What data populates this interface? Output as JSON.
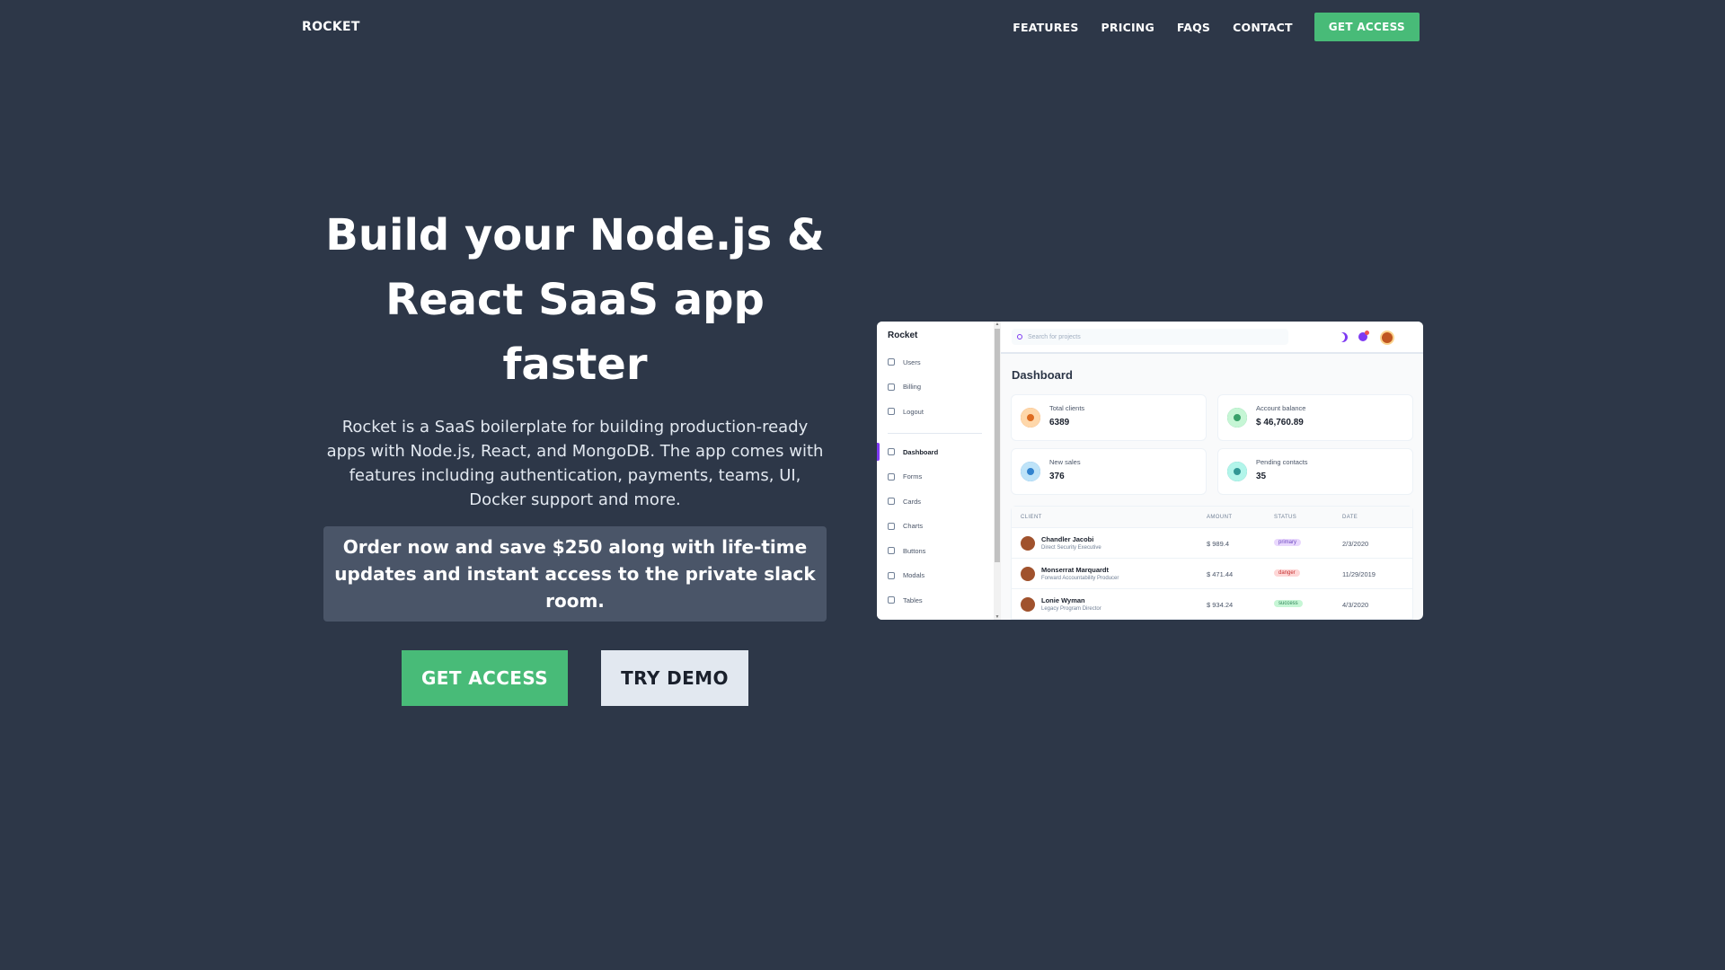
{
  "nav": {
    "logo": "ROCKET",
    "links": [
      "FEATURES",
      "PRICING",
      "FAQS",
      "CONTACT"
    ],
    "cta": "GET ACCESS"
  },
  "hero": {
    "title_lines": [
      "Build your Node.js &",
      "React SaaS app",
      "faster"
    ],
    "description": "Rocket is a SaaS boilerplate for building production-ready apps with Node.js, React, and MongoDB. The app comes with features including authentication, payments, teams, UI, Docker support and more.",
    "promo": "Order now and save $250 along with life-time updates and instant access to the private slack room.",
    "primary_button": "GET ACCESS",
    "secondary_button": "TRY DEMO"
  },
  "preview": {
    "brand": "Rocket",
    "sidebar_top": [
      "Users",
      "Billing",
      "Logout"
    ],
    "sidebar_main": [
      "Dashboard",
      "Forms",
      "Cards",
      "Charts",
      "Buttons",
      "Modals",
      "Tables"
    ],
    "active_item": "Dashboard",
    "search_placeholder": "Search for projects",
    "page_title": "Dashboard",
    "cards": [
      {
        "label": "Total clients",
        "value": "6389",
        "icon": "users-icon",
        "color": "#fed7aa",
        "fg": "#dd6b20"
      },
      {
        "label": "Account balance",
        "value": "$ 46,760.89",
        "icon": "cash-icon",
        "color": "#c6f6d5",
        "fg": "#38a169"
      },
      {
        "label": "New sales",
        "value": "376",
        "icon": "cart-icon",
        "color": "#bee3f8",
        "fg": "#3182ce"
      },
      {
        "label": "Pending contacts",
        "value": "35",
        "icon": "chat-icon",
        "color": "#b2f5ea",
        "fg": "#319795"
      }
    ],
    "table_headers": [
      "CLIENT",
      "AMOUNT",
      "STATUS",
      "DATE"
    ],
    "rows": [
      {
        "name": "Chandler Jacobi",
        "job": "Direct Security Executive",
        "amount": "$ 989.4",
        "status": "primary",
        "date": "2/3/2020"
      },
      {
        "name": "Monserrat Marquardt",
        "job": "Forward Accountability Producer",
        "amount": "$ 471.44",
        "status": "danger",
        "date": "11/29/2019"
      },
      {
        "name": "Lonie Wyman",
        "job": "Legacy Program Director",
        "amount": "$ 934.24",
        "status": "success",
        "date": "4/3/2020"
      }
    ],
    "status_colors": {
      "primary": {
        "bg": "#e9d8fd",
        "fg": "#6b46c1"
      },
      "danger": {
        "bg": "#fed7d7",
        "fg": "#c53030"
      },
      "success": {
        "bg": "#c6f6d5",
        "fg": "#2f855a"
      }
    }
  },
  "colors": {
    "background": "#2d3748",
    "accent": "#48bb78",
    "promo_bg": "#4a5568"
  }
}
